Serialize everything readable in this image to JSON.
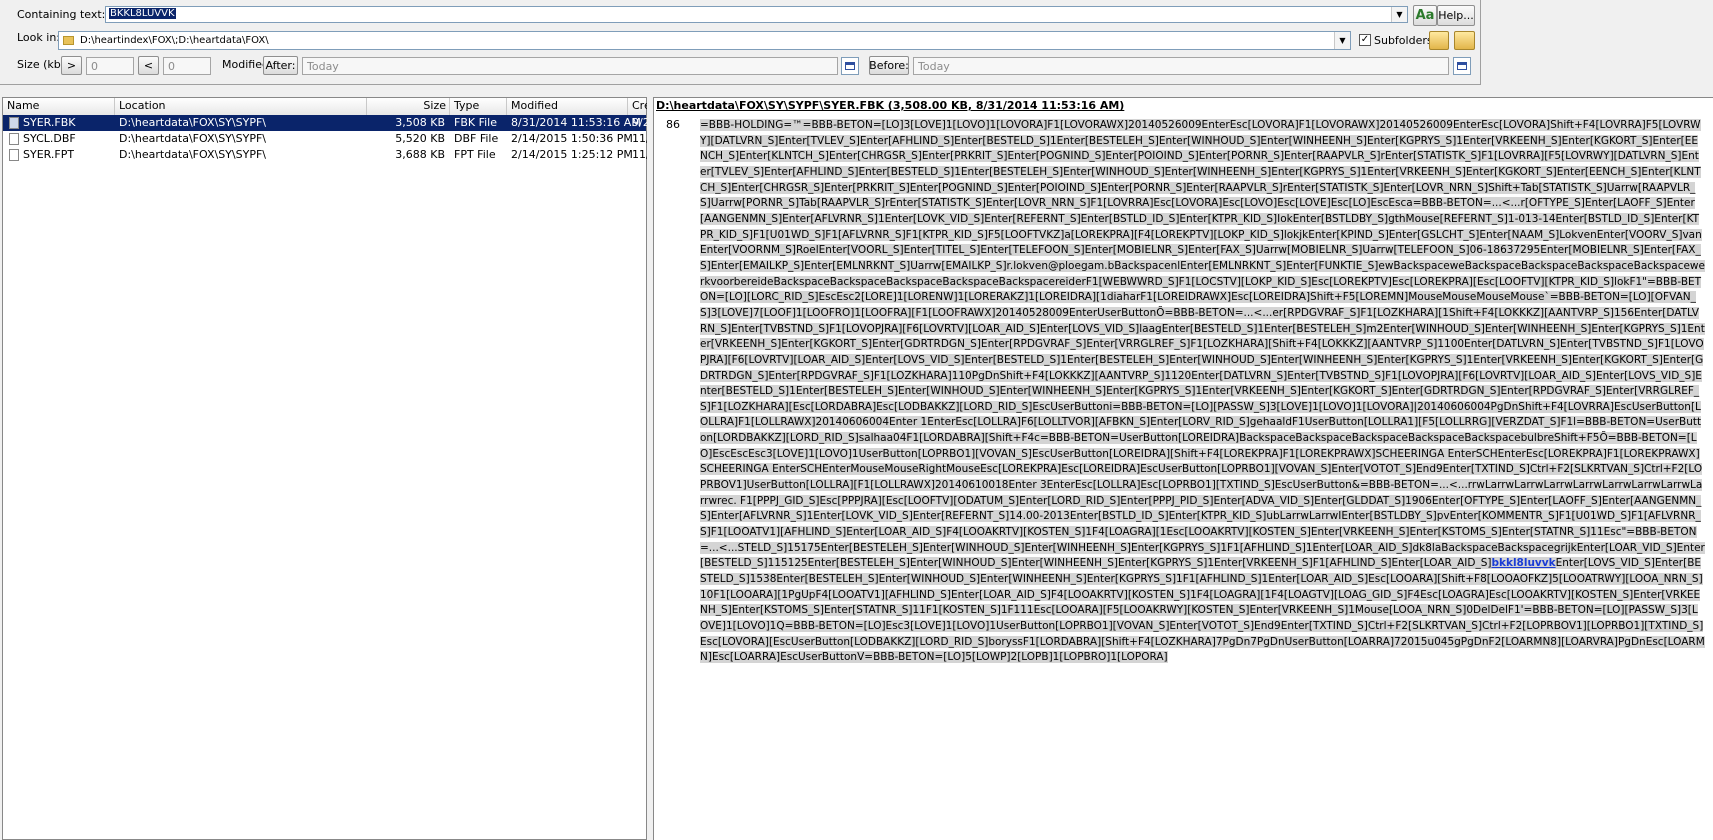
{
  "search": {
    "containing_label": "Containing text:",
    "containing_value": "BKKL8LUVVK",
    "case_button": "Aa",
    "help_button": "Help...",
    "lookin_label": "Look in:",
    "lookin_value": "D:\\heartindex\\FOX\\;D:\\heartdata\\FOX\\",
    "subfolders_label": "Subfolders",
    "subfolders_checked": true,
    "size_label": "Size (kb):",
    "size_gt": ">",
    "size_gt_value": "0",
    "size_lt": "<",
    "size_lt_value": "0",
    "modified_label": "Modified:",
    "after_button": "After:",
    "after_value": "Today",
    "before_button": "Before:",
    "before_value": "Today"
  },
  "results": {
    "columns": [
      "Name",
      "Location",
      "Size",
      "Type",
      "Modified",
      "Cre"
    ],
    "rows": [
      {
        "name": "SYER.FBK",
        "location": "D:\\heartdata\\FOX\\SY\\SYPF\\",
        "size": "3,508 KB",
        "type": "FBK File",
        "modified": "8/31/2014 11:53:16 AM",
        "created": "9/2",
        "selected": true
      },
      {
        "name": "SYCL.DBF",
        "location": "D:\\heartdata\\FOX\\SY\\SYPF\\",
        "size": "5,520 KB",
        "type": "DBF File",
        "modified": "2/14/2015 1:50:36 PM",
        "created": "11/",
        "selected": false
      },
      {
        "name": "SYER.FPT",
        "location": "D:\\heartdata\\FOX\\SY\\SYPF\\",
        "size": "3,688 KB",
        "type": "FPT File",
        "modified": "2/14/2015 1:25:12 PM",
        "created": "11/",
        "selected": false
      }
    ]
  },
  "preview": {
    "title": "D:\\heartdata\\FOX\\SY\\SYPF\\SYER.FBK   (3,508.00 KB,  8/31/2014 11:53:16 AM)",
    "line_number": "86",
    "text_before": "=BBB-HOLDING=™=BBB-BETON=[LO]3[LOVE]1[LOVO]1[LOVORA]F1[LOVORAWX]20140526009EnterEsc[LOVORA]F1[LOVORAWX]20140526009EnterEsc[LOVORA]Shift+F4[LOVRRA]F5[LOVRWY][DATLVRN_S]Enter[TVLEV_S]Enter[AFHLIND_S]Enter[BESTELD_S]1Enter[BESTELEH_S]Enter[WINHOUD_S]Enter[WINHEENH_S]Enter[KGPRYS_S]1Enter[VRKEENH_S]Enter[KGKORT_S]Enter[EENCH_S]Enter[KLNTCH_S]Enter[CHRGSR_S]Enter[PRKRIT_S]Enter[POGNIND_S]Enter[POIOIND_S]Enter[PORNR_S]Enter[RAAPVLR_S]rEnter[STATISTK_S]F1[LOVRRA][F5[LOVRWY][DATLVRN_S]Enter[TVLEV_S]Enter[AFHLIND_S]Enter[BESTELD_S]1Enter[BESTELEH_S]Enter[WINHOUD_S]Enter[WINHEENH_S]Enter[KGPRYS_S]1Enter[VRKEENH_S]Enter[KGKORT_S]Enter[EENCH_S]Enter[KLNTCH_S]Enter[CHRGSR_S]Enter[PRKRIT_S]Enter[POGNIND_S]Enter[POIOIND_S]Enter[PORNR_S]Enter[RAAPVLR_S]rEnter[STATISTK_S]Enter[LOVR_NRN_S]Shift+Tab[STATISTK_S]Uarrw[RAAPVLR_S]Uarrw[PORNR_S]Tab[RAAPVLR_S]rEnter[STATISTK_S]Enter[LOVR_NRN_S]F1[LOVRRA]Esc[LOVORA]Esc[LOVO]Esc[LOVE]Esc[LO]EscEsca=BBB-BETON=...<...r[OFTYPE_S]Enter[LAOFF_S]Enter[AANGENMN_S]Enter[AFLVRNR_S]1Enter[LOVK_VID_S]Enter[REFERNT_S]Enter[BSTLD_ID_S]Enter[KTPR_KID_S]IokEnter[BSTLDBY_S]gthMouse[REFERNT_S]1-013-14Enter[BSTLD_ID_S]Enter[KTPR_KID_S]F1[U01WD_S]F1[AFLVRNR_S]F1[KTPR_KID_S]F5[LOOFTVKZ]a[LOREKPRA][F4[LOREKPTV][LOKP_KID_S]lokjkEnter[KPIND_S]Enter[GSLCHT_S]Enter[NAAM_S]LokvenEnter[VOORV_S]vanEnter[VOORNM_S]RoelEnter[VOORL_S]Enter[TITEL_S]Enter[TELEFOON_S]Enter[MOBIELNR_S]Enter[FAX_S]Uarrw[MOBIELNR_S]Uarrw[TELEFOON_S]06-18637295Enter[MOBIELNR_S]Enter[FAX_S]Enter[EMAILKP_S]Enter[EMLNRKNT_S]Uarrw[EMAILKP_S]r.lokven@ploegam.bBackspacenlEnter[EMLNRKNT_S]Enter[FUNKTIE_S]ewBackspaceweBackspaceBackspaceBackspaceBackspacewerkvoorbereideBackspaceBackspaceBackspaceBackspaceBackspacereiderF1[WEBWWRD_S]F1[LOCSTV][LOKP_KID_S]Esc[LOREKPTV]Esc[LOREKPRA][Esc[LOOFTV][KTPR_KID_S]lokF1\"=BBB-BETON=[LO][LORC_RID_S]EscEsc2[LORE]1[LORENW]1[LORERAKZ]1[LOREIDRA][1diaharF1[LOREIDRAWX]Esc[LOREIDRA]Shift+F5[LOREMN]MouseMouseMouseMouse`=BBB-BETON=[LO][OFVAN_S]3[LOVE]7[LOOF]1[LOOFRO]1[LOOFRA][F1[LOOFRAWX]20140528009EnterUserButtonÕ=BBB-BETON=...<...er[RPDGVRAF_S]F1[LOZKHARA][1Shift+F4[LOKKKZ][AANTVRP_S]156Enter[DATLVRN_S]Enter[TVBSTND_S]F1[LOVOPJRA][F6[LOVRTV][LOAR_AID_S]Enter[LOVS_VID_S]laagEnter[BESTELD_S]1Enter[BESTELEH_S]m2Enter[WINHOUD_S]Enter[WINHEENH_S]Enter[KGPRYS_S]1Enter[VRKEENH_S]Enter[KGKORT_S]Enter[GDRTRDGN_S]Enter[RPDGVRAF_S]Enter[VRRGLREF_S]F1[LOZKHARA][Shift+F4[LOKKKZ][AANTVRP_S]1100Enter[DATLVRN_S]Enter[TVBSTND_S]F1[LOVOPJRA][F6[LOVRTV][LOAR_AID_S]Enter[LOVS_VID_S]Enter[BESTELD_S]1Enter[BESTELEH_S]Enter[WINHOUD_S]Enter[WINHEENH_S]Enter[KGPRYS_S]1Enter[VRKEENH_S]Enter[KGKORT_S]Enter[GDRTRDGN_S]Enter[RPDGVRAF_S]F1[LOZKHARA]110PgDnShift+F4[LOKKKZ][AANTVRP_S]1120Enter[DATLVRN_S]Enter[TVBSTND_S]F1[LOVOPJRA][F6[LOVRTV][LOAR_AID_S]Enter[LOVS_VID_S]Enter[BESTELD_S]1Enter[BESTELEH_S]Enter[WINHOUD_S]Enter[WINHEENH_S]Enter[KGPRYS_S]1Enter[VRKEENH_S]Enter[KGKORT_S]Enter[GDRTRDGN_S]Enter[RPDGVRAF_S]Enter[VRRGLREF_S]F1[LOZKHARA][Esc[LORDABRA]Esc[LODBAKKZ][LORD_RID_S]EscUserButtoni=BBB-BETON=[LO][PASSW_S]3[LOVE]1[LOVO]1[LOVORA]|20140606004PgDnShift+F4[LOVRRA]EscUserButton[LOLLRA]F1[LOLLRAWX]20140606004Enter 1EnterEsc[LOLLRA]F6[LOLLTVOR][AFBKN_S]Enter[LORV_RID_S]gehaaldF1UserButton[LOLLRA1][F5[LOLLRRG][VERZDAT_S]F1l=BBB-BETON=UserButton[LORDBAKKZ][LORD_RID_S]salhaa04F1[LORDABRA][Shift+F4c=BBB-BETON=UserButton[LOREIDRA]BackspaceBackspaceBackspaceBackspaceBackspacebulbreShift+F5Õ=BBB-BETON=[LO]EscEscEsc3[LOVE]1[LOVO]1UserButton[LOPRBO1][VOVAN_S]EscUserButton[LOREIDRA][Shift+F4[LOREKPRA]F1[LOREKPRAWX]SCHEERINGA EnterSCHEnterEsc[LOREKPRA]F1[LOREKPRAWX]SCHEERINGA EnterSCHEnterMouseMouseRightMouseEsc[LOREKPRA]Esc[LOREIDRA]EscUserButton[LOPRBO1][VOVAN_S]Enter[VOTOT_S]End9Enter[TXTIND_S]Ctrl+F2[SLKRTVAN_S]Ctrl+F2[LOPRBOV1]UserButton[LOLLRA][F1[LOLLRAWX]20140610018Enter 3EnterEsc[LOLLRA]Esc[LOPRBO1][TXTIND_S]EscUserButton&=BBB-BETON=...<...rrwLarrwLarrwLarrwLarrwLarrwLarrwLarrwLarrwrec. F1[PPPJ_GID_S]Esc[PPPJRA][Esc[LOOFTV][ODATUM_S]Enter[LORD_RID_S]Enter[PPPJ_PID_S]Enter[ADVA_VID_S]Enter[GLDDAT_S]1906Enter[OFTYPE_S]Enter[LAOFF_S]Enter[AANGENMN_S]Enter[AFLVRNR_S]1Enter[LOVK_VID_S]Enter[REFERNT_S]14.00-2013Enter[BSTLD_ID_S]Enter[KTPR_KID_S]ubLarrwLarrwIEnter[BSTLDBY_S]pvEnter[KOMMENTR_S]F1[U01WD_S]F1[AFLVRNR_S]F1[LOOATV1][AFHLIND_S]Enter[LOAR_AID_S]F4[LOOAKRTV][KOSTEN_S]1F4[LOAGRA][1Esc[LOOAKRTV][KOSTEN_S]Enter[VRKEENH_S]Enter[KSTOMS_S]Enter[STATNR_S]11Esc\"=BBB-BETON=...<...STELD_S]15175Enter[BESTELEH_S]Enter[WINHOUD_S]Enter[WINHEENH_S]Enter[KGPRYS_S]1F1[AFHLIND_S]1Enter[LOAR_AID_S]dk8laBackspaceBackspacegrijkEnter[LOAR_VID_S]Enter[BESTELD_S]115125Enter[BESTELEH_S]Enter[WINHOUD_S]Enter[WINHEENH_S]Enter[KGPRYS_S]1Enter[VRKEENH_S]F1[AFHLIND_S]Enter[LOAR_AID_S]",
    "match": "bkkl8luvvk",
    "text_after": "Enter[LOVS_VID_S]Enter[BESTELD_S]1538Enter[BESTELEH_S]Enter[WINHOUD_S]Enter[WINHEENH_S]Enter[KGPRYS_S]1F1[AFHLIND_S]1Enter[LOAR_AID_S]Esc[LOOARA][Shift+F8[LOOAOFKZ]5[LOOATRWY][LOOA_NRN_S]10F1[LOOARA][1PgUpF4[LOOATV1][AFHLIND_S]Enter[LOAR_AID_S]F4[LOOAKRTV][KOSTEN_S]1F4[LOAGRA][1F4[LOAGTV][LOAG_GID_S]F4Esc[LOAGRA]Esc[LOOAKRTV][KOSTEN_S]Enter[VRKEENH_S]Enter[KSTOMS_S]Enter[STATNR_S]11F1[KOSTEN_S]1F111Esc[LOOARA][F5[LOOAKRWY][KOSTEN_S]Enter[VRKEENH_S]1Mouse[LOOA_NRN_S]0DelDelF1'=BBB-BETON=[LO][PASSW_S]3[LOVE]1[LOVO]1Q=BBB-BETON=[LO]Esc3[LOVE]1[LOVO]1UserButton[LOPRBO1][VOVAN_S]Enter[VOTOT_S]End9Enter[TXTIND_S]Ctrl+F2[SLKRTVAN_S]Ctrl+F2[LOPRBOV1][LOPRBO1][TXTIND_S]Esc[LOVORA][EscUserButton[LODBAKKZ][LORD_RID_S]boryssF1[LORDABRA][Shift+F4[LOZKHARA]7PgDn7PgDnUserButton[LOARRA]72015u045gPgDnF2[LOARMN8][LOARVRA]PgDnEsc[LOARMN]Esc[LOARRA]EscUserButtonV=BBB-BETON=[LO]5[LOWP]2[LOPB]1[LOPBRO]1[LOPORA]"
  }
}
